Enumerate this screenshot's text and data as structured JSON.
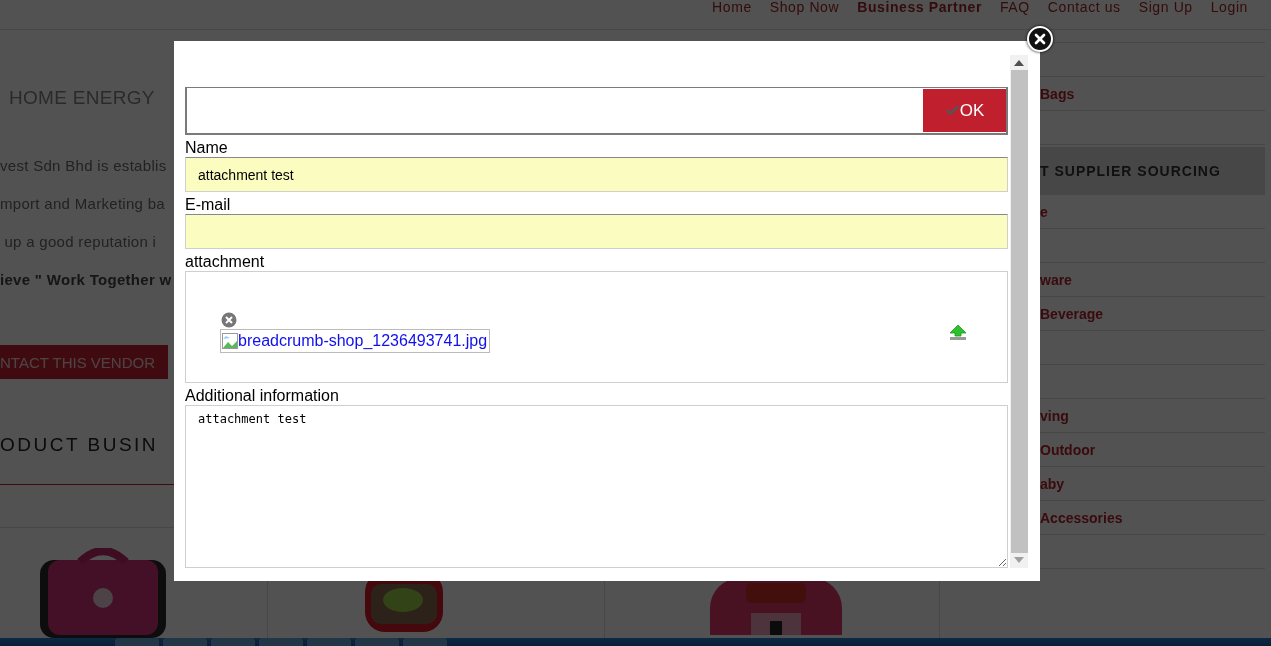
{
  "nav": {
    "links": [
      {
        "label": "Home",
        "selected": false
      },
      {
        "label": "Shop Now",
        "selected": false
      },
      {
        "label": "Business Partner",
        "selected": true
      },
      {
        "label": "FAQ",
        "selected": false
      },
      {
        "label": "Contact us",
        "selected": false
      },
      {
        "label": "Sign Up",
        "selected": false
      },
      {
        "label": "Login",
        "selected": false
      }
    ]
  },
  "page": {
    "logo": "HOME ENERGY",
    "intro_lines": [
      {
        "text": "vest Sdn Bhd is establis",
        "bold": false
      },
      {
        "text": "mport and Marketing ba",
        "bold": false
      },
      {
        "text": " up a good reputation i",
        "bold": false
      },
      {
        "text": "ieve \" Work Together w",
        "bold": true
      }
    ],
    "contact_button": "NTACT THIS VENDOR",
    "section_heading": "ODUCT BUSIN"
  },
  "sidebar": {
    "rows": [
      {
        "kind": "item"
      },
      {
        "kind": "item",
        "label": "Bags"
      },
      {
        "kind": "item"
      },
      {
        "kind": "header",
        "label": "T SUPPLIER SOURCING"
      },
      {
        "kind": "item",
        "label": "e"
      },
      {
        "kind": "item"
      },
      {
        "kind": "item",
        "label": "ware"
      },
      {
        "kind": "item",
        "label": "Beverage"
      },
      {
        "kind": "item"
      },
      {
        "kind": "item"
      },
      {
        "kind": "item",
        "label": "ving"
      },
      {
        "kind": "item",
        "label": "Outdoor"
      },
      {
        "kind": "item",
        "label": "aby"
      },
      {
        "kind": "item",
        "label": "Accessories"
      },
      {
        "kind": "item"
      }
    ]
  },
  "dialog": {
    "ok_button": "OK",
    "fields": [
      {
        "kind": "text",
        "label": "Name",
        "value": "attachment test"
      },
      {
        "kind": "text",
        "label": "E-mail"
      },
      {
        "kind": "attachment",
        "label": "attachment",
        "file": "breadcrumb-shop_1236493741.jpg"
      },
      {
        "kind": "textarea",
        "label": "Additional information",
        "value": "attachment test"
      }
    ]
  }
}
